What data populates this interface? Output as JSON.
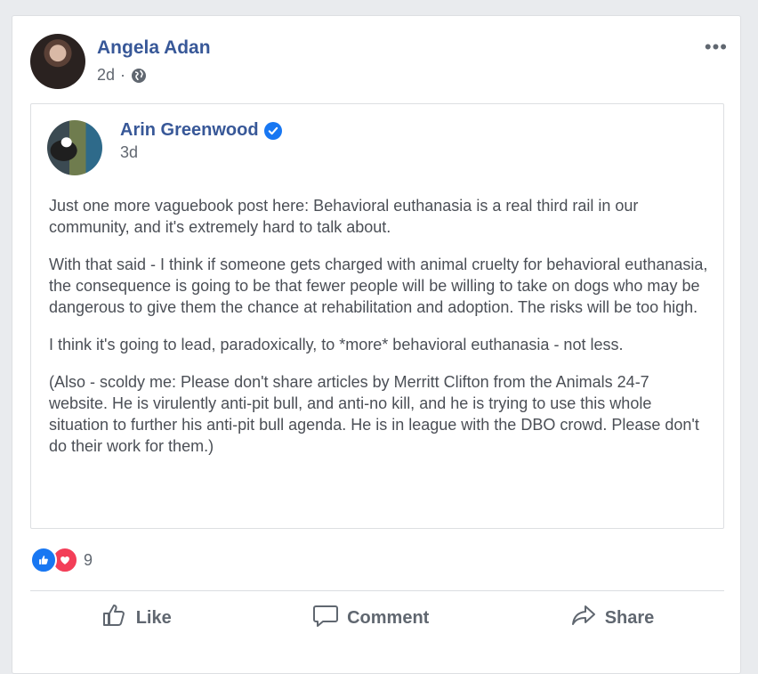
{
  "post": {
    "author": "Angela Adan",
    "time": "2d",
    "separator": "·",
    "more_label": "•••"
  },
  "shared_post": {
    "author": "Arin Greenwood",
    "time": "3d",
    "paragraphs": [
      "Just one more vaguebook post here: Behavioral euthanasia is a real third rail in our community, and it's extremely hard to talk about.",
      "With that said - I think if someone gets charged with animal cruelty for behavioral euthanasia, the consequence is going to be that fewer people will be willing to take on dogs who may be dangerous to give them the chance at rehabilitation and adoption. The risks will be too high.",
      "I think it's going to lead, paradoxically, to *more* behavioral euthanasia - not less.",
      "(Also - scoldy me: Please don't share articles by Merritt Clifton from the Animals 24-7 website. He is virulently anti-pit bull, and anti-no kill, and he is trying to use this whole situation to further his anti-pit bull agenda. He is in league with the DBO crowd. Please don't do their work for them.)"
    ]
  },
  "reactions": {
    "count": "9",
    "types": [
      "like-icon",
      "love-icon"
    ]
  },
  "actions": {
    "like": "Like",
    "comment": "Comment",
    "share": "Share"
  },
  "colors": {
    "name_link": "#385898",
    "like_blue": "#1877f2",
    "love_red": "#f33e58",
    "muted": "#606770"
  }
}
